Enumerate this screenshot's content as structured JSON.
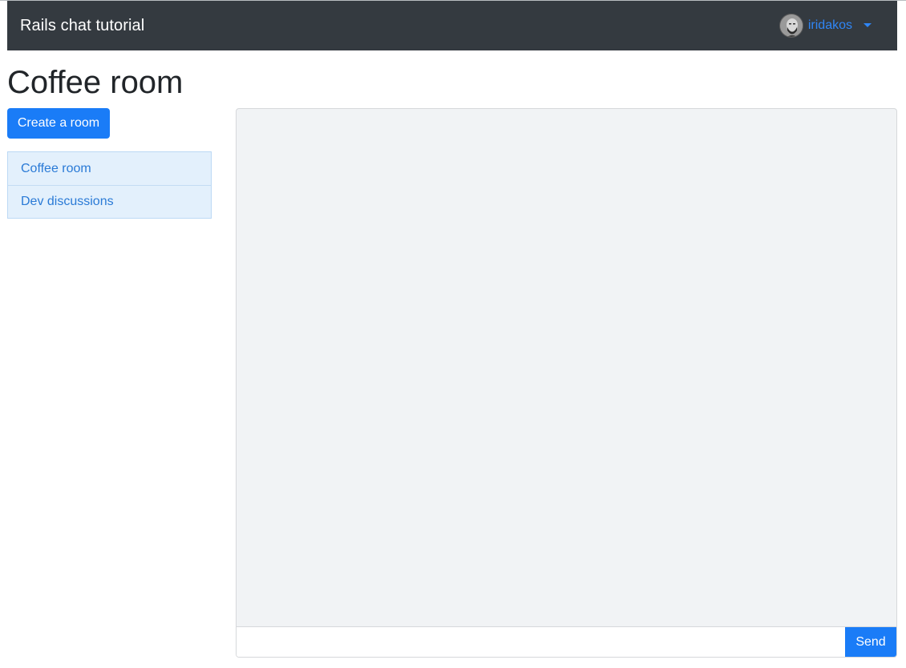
{
  "navbar": {
    "brand": "Rails chat tutorial",
    "user": {
      "name": "iridakos",
      "avatar_icon": "user-avatar"
    }
  },
  "page": {
    "title": "Coffee room"
  },
  "sidebar": {
    "create_button": "Create a room",
    "rooms": [
      {
        "label": "Coffee room"
      },
      {
        "label": "Dev discussions"
      }
    ]
  },
  "chat": {
    "message_input_value": "",
    "message_input_placeholder": "",
    "send_label": "Send"
  },
  "colors": {
    "navbar_bg": "#343a40",
    "primary": "#1a7cf7",
    "link": "#2f86f6",
    "list_bg": "#e3f0fc",
    "chat_bg": "#f1f3f5"
  }
}
